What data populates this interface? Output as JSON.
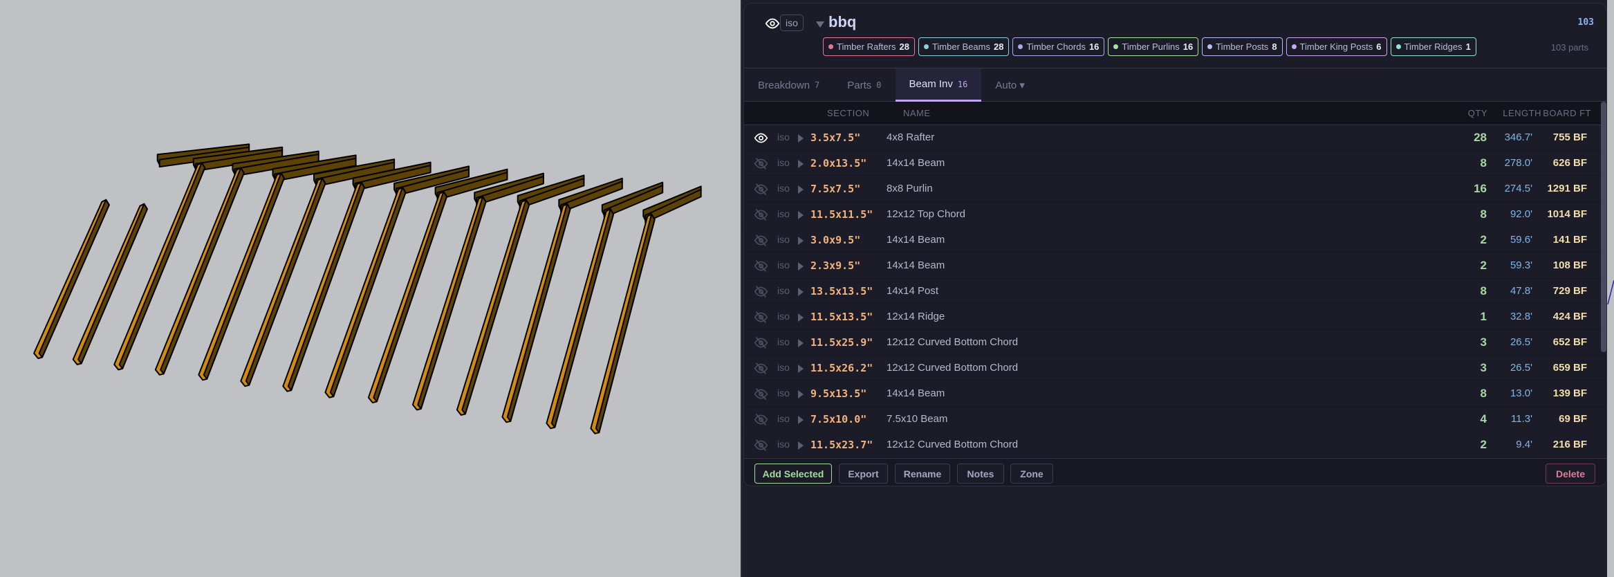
{
  "scene": {
    "colors": {
      "background": "#c0c1c5",
      "timber_side": "#d18b12",
      "timber_top": "#5c4205",
      "outline": "#000000"
    }
  },
  "header": {
    "eye_icon": "eye-icon",
    "iso_label": "iso",
    "title": "bbq",
    "total": "103",
    "parts_label": "103 parts"
  },
  "chips": [
    {
      "label": "Timber Rafters",
      "count": "28",
      "color": "#e07a93"
    },
    {
      "label": "Timber Beams",
      "count": "28",
      "color": "#89d2dc"
    },
    {
      "label": "Timber Chords",
      "count": "16",
      "color": "#a9a9f0"
    },
    {
      "label": "Timber Purlins",
      "count": "16",
      "color": "#a6e3a1"
    },
    {
      "label": "Timber Posts",
      "count": "8",
      "color": "#b4befe"
    },
    {
      "label": "Timber King Posts",
      "count": "6",
      "color": "#cba6f7"
    },
    {
      "label": "Timber Ridges",
      "count": "1",
      "color": "#94e2d5"
    }
  ],
  "tabs": [
    {
      "label": "Breakdown",
      "count": "7"
    },
    {
      "label": "Parts",
      "count": "0"
    },
    {
      "label": "Beam Inv",
      "count": "16"
    },
    {
      "label": "Auto ▾",
      "count": ""
    }
  ],
  "columns": {
    "section": "SECTION",
    "name": "NAME",
    "qty": "QTY",
    "length": "LENGTH",
    "board_ft": "BOARD FT"
  },
  "rows": [
    {
      "visible": true,
      "iso": "iso",
      "section": "3.5x7.5\"",
      "name": "4x8 Rafter",
      "qty": "28",
      "length": "346.7'",
      "bf": "755 BF"
    },
    {
      "visible": false,
      "iso": "iso",
      "section": "2.0x13.5\"",
      "name": "14x14 Beam",
      "qty": "8",
      "length": "278.0'",
      "bf": "626 BF"
    },
    {
      "visible": false,
      "iso": "iso",
      "section": "7.5x7.5\"",
      "name": "8x8 Purlin",
      "qty": "16",
      "length": "274.5'",
      "bf": "1291 BF"
    },
    {
      "visible": false,
      "iso": "iso",
      "section": "11.5x11.5\"",
      "name": "12x12 Top Chord",
      "qty": "8",
      "length": "92.0'",
      "bf": "1014 BF"
    },
    {
      "visible": false,
      "iso": "iso",
      "section": "3.0x9.5\"",
      "name": "14x14 Beam",
      "qty": "2",
      "length": "59.6'",
      "bf": "141 BF"
    },
    {
      "visible": false,
      "iso": "iso",
      "section": "2.3x9.5\"",
      "name": "14x14 Beam",
      "qty": "2",
      "length": "59.3'",
      "bf": "108 BF"
    },
    {
      "visible": false,
      "iso": "iso",
      "section": "13.5x13.5\"",
      "name": "14x14 Post",
      "qty": "8",
      "length": "47.8'",
      "bf": "729 BF"
    },
    {
      "visible": false,
      "iso": "iso",
      "section": "11.5x13.5\"",
      "name": "12x14 Ridge",
      "qty": "1",
      "length": "32.8'",
      "bf": "424 BF"
    },
    {
      "visible": false,
      "iso": "iso",
      "section": "11.5x25.9\"",
      "name": "12x12 Curved Bottom Chord",
      "qty": "3",
      "length": "26.5'",
      "bf": "652 BF"
    },
    {
      "visible": false,
      "iso": "iso",
      "section": "11.5x26.2\"",
      "name": "12x12 Curved Bottom Chord",
      "qty": "3",
      "length": "26.5'",
      "bf": "659 BF"
    },
    {
      "visible": false,
      "iso": "iso",
      "section": "9.5x13.5\"",
      "name": "14x14 Beam",
      "qty": "8",
      "length": "13.0'",
      "bf": "139 BF"
    },
    {
      "visible": false,
      "iso": "iso",
      "section": "7.5x10.0\"",
      "name": "7.5x10 Beam",
      "qty": "4",
      "length": "11.3'",
      "bf": "69 BF"
    },
    {
      "visible": false,
      "iso": "iso",
      "section": "11.5x23.7\"",
      "name": "12x12 Curved Bottom Chord",
      "qty": "2",
      "length": "9.4'",
      "bf": "216 BF"
    }
  ],
  "footer": {
    "add_selected": "Add Selected",
    "export": "Export",
    "rename": "Rename",
    "notes": "Notes",
    "zone": "Zone",
    "delete": "Delete"
  }
}
